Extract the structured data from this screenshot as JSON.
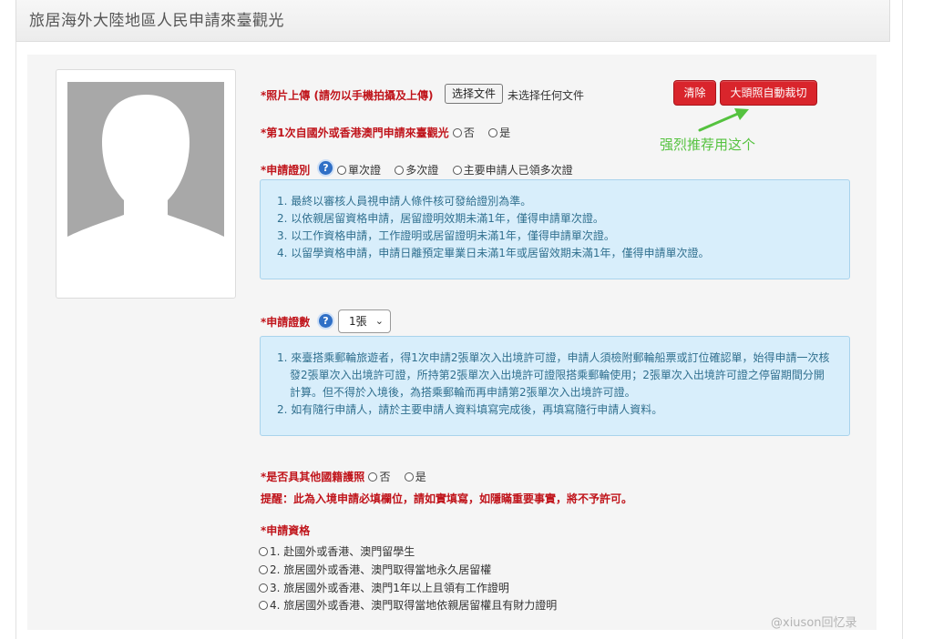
{
  "page": {
    "title": "旅居海外大陸地區人民申請來臺觀光"
  },
  "upload": {
    "label": "*照片上傳",
    "note": "(請勿以手機拍攝及上傳)",
    "choose_button": "选择文件",
    "no_file_text": "未选择任何文件",
    "clear_button": "清除",
    "autocrop_button": "大頭照自動裁切",
    "annotation": "强烈推荐用这个"
  },
  "first_time": {
    "label": "*第1次自國外或香港澳門申請來臺觀光",
    "options": [
      "否",
      "是"
    ]
  },
  "permit_type": {
    "label": "*申請證別",
    "options": [
      "單次證",
      "多次證",
      "主要申請人已領多次證"
    ],
    "notes": [
      "1. 最終以審核人員視申請人條件核可發給證別為準。",
      "2. 以依親居留資格申請，居留證明效期未滿1年，僅得申請單次證。",
      "3. 以工作資格申請，工作證明或居留證明未滿1年，僅得申請單次證。",
      "4. 以留學資格申請，申請日離預定畢業日未滿1年或居留效期未滿1年，僅得申請單次證。"
    ]
  },
  "permit_count": {
    "label": "*申請證數",
    "selected": "1張",
    "notes": [
      "1. 來臺搭乘郵輪旅遊者，得1次申請2張單次入出境許可證，申請人須檢附郵輪船票或訂位確認單，始得申請一次核發2張單次入出境許可證，所持第2張單次入出境許可證限搭乘郵輪使用；2張單次入出境許可證之停留期間分開計算。但不得於入境後，為搭乘郵輪而再申請第2張單次入出境許可證。",
      "2. 如有隨行申請人，請於主要申請人資料填寫完成後，再填寫隨行申請人資料。"
    ]
  },
  "other_passport": {
    "label": "*是否具其他國籍護照",
    "options": [
      "否",
      "是"
    ],
    "warning": "提醒：此為入境申請必填欄位，請如實填寫，如隱瞞重要事實，將不予許可。"
  },
  "qualification": {
    "label": "*申請資格",
    "options": [
      "1. 赴國外或香港、澳門留學生",
      "2. 旅居國外或香港、澳門取得當地永久居留權",
      "3. 旅居國外或香港、澳門1年以上且領有工作證明",
      "4. 旅居國外或香港、澳門取得當地依親居留權且有財力證明"
    ]
  },
  "watermark": "@xiuson回忆录",
  "colors": {
    "required_red": "#c0141b",
    "button_red": "#d9252c",
    "info_bg": "#d8eefb",
    "info_text": "#31708f",
    "annotation_green": "#55c23f"
  }
}
